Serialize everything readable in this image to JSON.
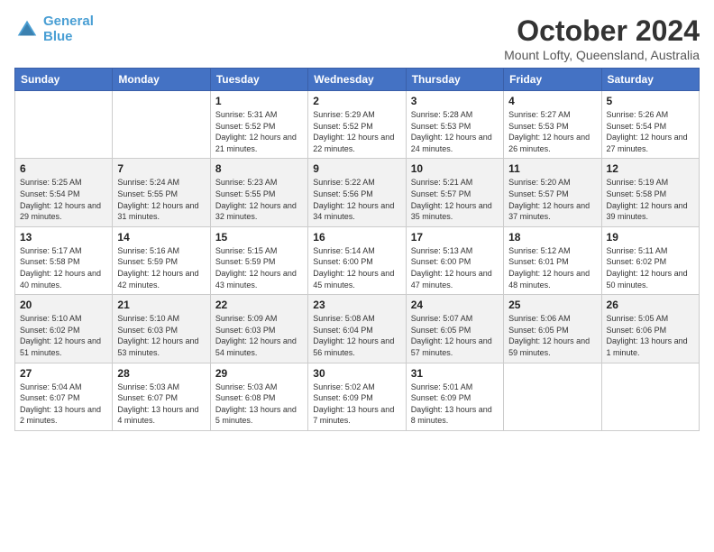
{
  "logo": {
    "line1": "General",
    "line2": "Blue"
  },
  "title": "October 2024",
  "subtitle": "Mount Lofty, Queensland, Australia",
  "headers": [
    "Sunday",
    "Monday",
    "Tuesday",
    "Wednesday",
    "Thursday",
    "Friday",
    "Saturday"
  ],
  "weeks": [
    [
      {
        "day": "",
        "sunrise": "",
        "sunset": "",
        "daylight": ""
      },
      {
        "day": "",
        "sunrise": "",
        "sunset": "",
        "daylight": ""
      },
      {
        "day": "1",
        "sunrise": "Sunrise: 5:31 AM",
        "sunset": "Sunset: 5:52 PM",
        "daylight": "Daylight: 12 hours and 21 minutes."
      },
      {
        "day": "2",
        "sunrise": "Sunrise: 5:29 AM",
        "sunset": "Sunset: 5:52 PM",
        "daylight": "Daylight: 12 hours and 22 minutes."
      },
      {
        "day": "3",
        "sunrise": "Sunrise: 5:28 AM",
        "sunset": "Sunset: 5:53 PM",
        "daylight": "Daylight: 12 hours and 24 minutes."
      },
      {
        "day": "4",
        "sunrise": "Sunrise: 5:27 AM",
        "sunset": "Sunset: 5:53 PM",
        "daylight": "Daylight: 12 hours and 26 minutes."
      },
      {
        "day": "5",
        "sunrise": "Sunrise: 5:26 AM",
        "sunset": "Sunset: 5:54 PM",
        "daylight": "Daylight: 12 hours and 27 minutes."
      }
    ],
    [
      {
        "day": "6",
        "sunrise": "Sunrise: 5:25 AM",
        "sunset": "Sunset: 5:54 PM",
        "daylight": "Daylight: 12 hours and 29 minutes."
      },
      {
        "day": "7",
        "sunrise": "Sunrise: 5:24 AM",
        "sunset": "Sunset: 5:55 PM",
        "daylight": "Daylight: 12 hours and 31 minutes."
      },
      {
        "day": "8",
        "sunrise": "Sunrise: 5:23 AM",
        "sunset": "Sunset: 5:55 PM",
        "daylight": "Daylight: 12 hours and 32 minutes."
      },
      {
        "day": "9",
        "sunrise": "Sunrise: 5:22 AM",
        "sunset": "Sunset: 5:56 PM",
        "daylight": "Daylight: 12 hours and 34 minutes."
      },
      {
        "day": "10",
        "sunrise": "Sunrise: 5:21 AM",
        "sunset": "Sunset: 5:57 PM",
        "daylight": "Daylight: 12 hours and 35 minutes."
      },
      {
        "day": "11",
        "sunrise": "Sunrise: 5:20 AM",
        "sunset": "Sunset: 5:57 PM",
        "daylight": "Daylight: 12 hours and 37 minutes."
      },
      {
        "day": "12",
        "sunrise": "Sunrise: 5:19 AM",
        "sunset": "Sunset: 5:58 PM",
        "daylight": "Daylight: 12 hours and 39 minutes."
      }
    ],
    [
      {
        "day": "13",
        "sunrise": "Sunrise: 5:17 AM",
        "sunset": "Sunset: 5:58 PM",
        "daylight": "Daylight: 12 hours and 40 minutes."
      },
      {
        "day": "14",
        "sunrise": "Sunrise: 5:16 AM",
        "sunset": "Sunset: 5:59 PM",
        "daylight": "Daylight: 12 hours and 42 minutes."
      },
      {
        "day": "15",
        "sunrise": "Sunrise: 5:15 AM",
        "sunset": "Sunset: 5:59 PM",
        "daylight": "Daylight: 12 hours and 43 minutes."
      },
      {
        "day": "16",
        "sunrise": "Sunrise: 5:14 AM",
        "sunset": "Sunset: 6:00 PM",
        "daylight": "Daylight: 12 hours and 45 minutes."
      },
      {
        "day": "17",
        "sunrise": "Sunrise: 5:13 AM",
        "sunset": "Sunset: 6:00 PM",
        "daylight": "Daylight: 12 hours and 47 minutes."
      },
      {
        "day": "18",
        "sunrise": "Sunrise: 5:12 AM",
        "sunset": "Sunset: 6:01 PM",
        "daylight": "Daylight: 12 hours and 48 minutes."
      },
      {
        "day": "19",
        "sunrise": "Sunrise: 5:11 AM",
        "sunset": "Sunset: 6:02 PM",
        "daylight": "Daylight: 12 hours and 50 minutes."
      }
    ],
    [
      {
        "day": "20",
        "sunrise": "Sunrise: 5:10 AM",
        "sunset": "Sunset: 6:02 PM",
        "daylight": "Daylight: 12 hours and 51 minutes."
      },
      {
        "day": "21",
        "sunrise": "Sunrise: 5:10 AM",
        "sunset": "Sunset: 6:03 PM",
        "daylight": "Daylight: 12 hours and 53 minutes."
      },
      {
        "day": "22",
        "sunrise": "Sunrise: 5:09 AM",
        "sunset": "Sunset: 6:03 PM",
        "daylight": "Daylight: 12 hours and 54 minutes."
      },
      {
        "day": "23",
        "sunrise": "Sunrise: 5:08 AM",
        "sunset": "Sunset: 6:04 PM",
        "daylight": "Daylight: 12 hours and 56 minutes."
      },
      {
        "day": "24",
        "sunrise": "Sunrise: 5:07 AM",
        "sunset": "Sunset: 6:05 PM",
        "daylight": "Daylight: 12 hours and 57 minutes."
      },
      {
        "day": "25",
        "sunrise": "Sunrise: 5:06 AM",
        "sunset": "Sunset: 6:05 PM",
        "daylight": "Daylight: 12 hours and 59 minutes."
      },
      {
        "day": "26",
        "sunrise": "Sunrise: 5:05 AM",
        "sunset": "Sunset: 6:06 PM",
        "daylight": "Daylight: 13 hours and 1 minute."
      }
    ],
    [
      {
        "day": "27",
        "sunrise": "Sunrise: 5:04 AM",
        "sunset": "Sunset: 6:07 PM",
        "daylight": "Daylight: 13 hours and 2 minutes."
      },
      {
        "day": "28",
        "sunrise": "Sunrise: 5:03 AM",
        "sunset": "Sunset: 6:07 PM",
        "daylight": "Daylight: 13 hours and 4 minutes."
      },
      {
        "day": "29",
        "sunrise": "Sunrise: 5:03 AM",
        "sunset": "Sunset: 6:08 PM",
        "daylight": "Daylight: 13 hours and 5 minutes."
      },
      {
        "day": "30",
        "sunrise": "Sunrise: 5:02 AM",
        "sunset": "Sunset: 6:09 PM",
        "daylight": "Daylight: 13 hours and 7 minutes."
      },
      {
        "day": "31",
        "sunrise": "Sunrise: 5:01 AM",
        "sunset": "Sunset: 6:09 PM",
        "daylight": "Daylight: 13 hours and 8 minutes."
      },
      {
        "day": "",
        "sunrise": "",
        "sunset": "",
        "daylight": ""
      },
      {
        "day": "",
        "sunrise": "",
        "sunset": "",
        "daylight": ""
      }
    ]
  ]
}
